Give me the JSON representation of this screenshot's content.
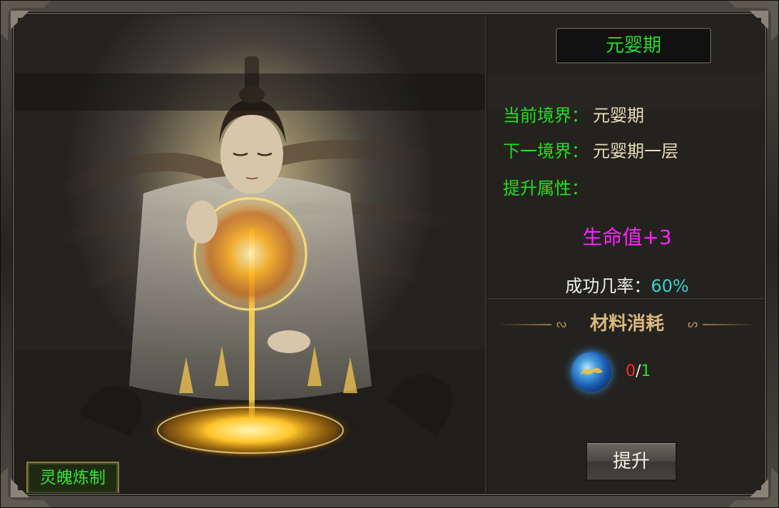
{
  "realm_title": "元婴期",
  "info": {
    "current_label": "当前境界：",
    "current_value": "元婴期",
    "next_label": "下一境界：",
    "next_value": "元婴期一层",
    "attr_label": "提升属性："
  },
  "attribute_bonus": "生命值+3",
  "success_rate": {
    "label": "成功几率：",
    "value": "60%"
  },
  "materials": {
    "title": "材料消耗",
    "item_icon": "blue-cloud-orb-icon",
    "have": "0",
    "separator": "/",
    "need": "1"
  },
  "buttons": {
    "upgrade": "提升",
    "soul_refine": "灵魄炼制"
  },
  "colors": {
    "green_label": "#22e022",
    "value_text": "#e6dbb7",
    "attribute": "#ff22ff",
    "rate_value": "#3ad0d0",
    "material_header": "#d8b87c"
  }
}
